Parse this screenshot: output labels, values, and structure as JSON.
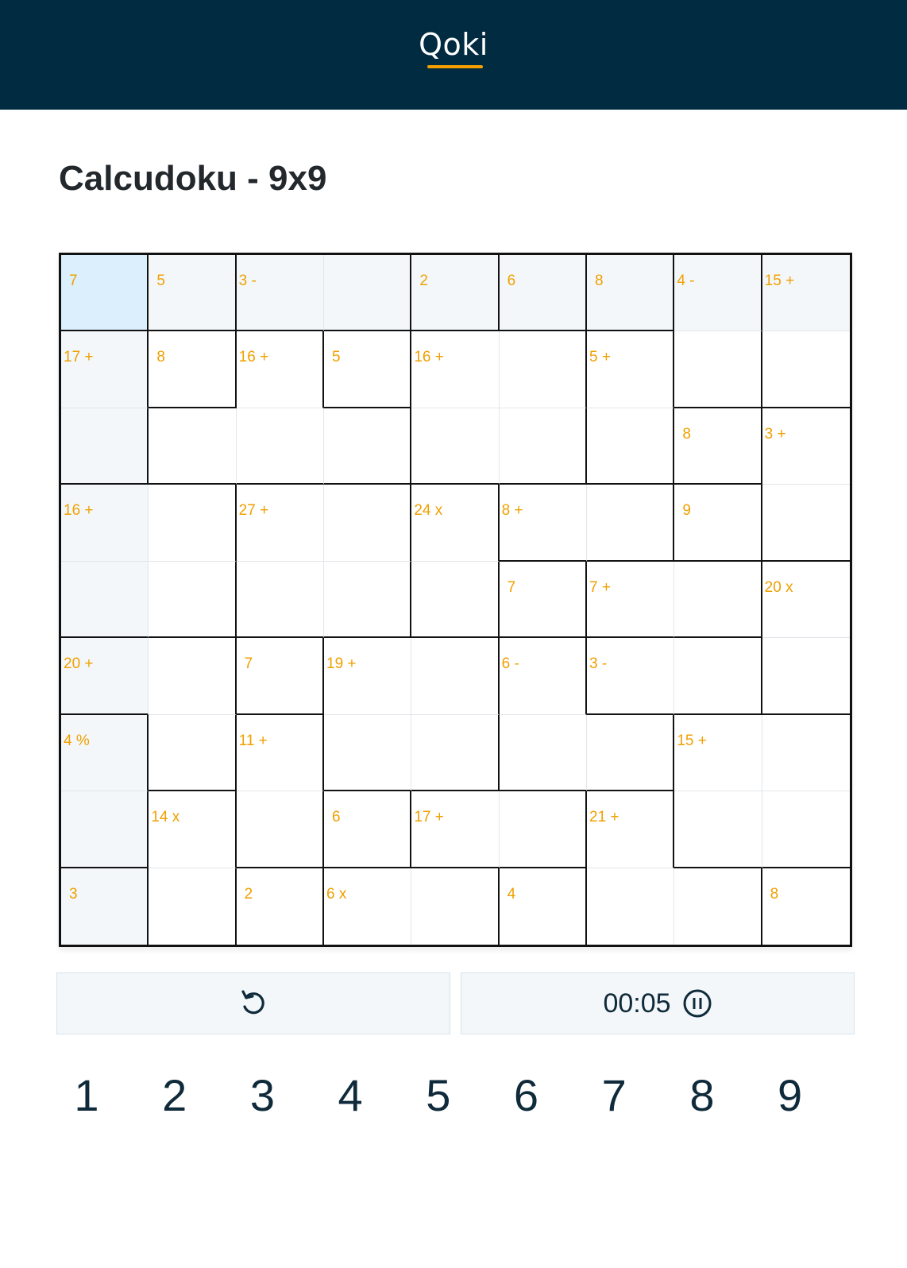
{
  "header": {
    "logo": "Qoki"
  },
  "page": {
    "title": "Calcudoku - 9x9"
  },
  "puzzle": {
    "size": 9,
    "selected": [
      0,
      0
    ],
    "accent_color": "#f0a000",
    "cage_map": [
      [
        0,
        1,
        2,
        2,
        3,
        4,
        5,
        6,
        7
      ],
      [
        8,
        9,
        10,
        11,
        12,
        12,
        13,
        6,
        7
      ],
      [
        8,
        10,
        10,
        10,
        12,
        12,
        13,
        14,
        15
      ],
      [
        16,
        16,
        17,
        17,
        18,
        19,
        19,
        20,
        15
      ],
      [
        16,
        16,
        17,
        17,
        18,
        21,
        22,
        22,
        23
      ],
      [
        24,
        24,
        25,
        26,
        26,
        27,
        28,
        28,
        23
      ],
      [
        29,
        24,
        30,
        26,
        26,
        27,
        27,
        31,
        31
      ],
      [
        29,
        32,
        30,
        33,
        34,
        34,
        35,
        31,
        31
      ],
      [
        36,
        32,
        37,
        38,
        38,
        39,
        35,
        35,
        40
      ]
    ],
    "cages": [
      {
        "id": 0,
        "label": "7",
        "row": 0,
        "col": 0
      },
      {
        "id": 1,
        "label": "5",
        "row": 0,
        "col": 1
      },
      {
        "id": 2,
        "label": "3 -",
        "row": 0,
        "col": 2
      },
      {
        "id": 3,
        "label": "2",
        "row": 0,
        "col": 4
      },
      {
        "id": 4,
        "label": "6",
        "row": 0,
        "col": 5
      },
      {
        "id": 5,
        "label": "8",
        "row": 0,
        "col": 6
      },
      {
        "id": 6,
        "label": "4 -",
        "row": 0,
        "col": 7
      },
      {
        "id": 7,
        "label": "15 +",
        "row": 0,
        "col": 8
      },
      {
        "id": 8,
        "label": "17 +",
        "row": 1,
        "col": 0
      },
      {
        "id": 9,
        "label": "8",
        "row": 1,
        "col": 1
      },
      {
        "id": 10,
        "label": "16 +",
        "row": 1,
        "col": 2
      },
      {
        "id": 11,
        "label": "5",
        "row": 1,
        "col": 3
      },
      {
        "id": 12,
        "label": "16 +",
        "row": 1,
        "col": 4
      },
      {
        "id": 13,
        "label": "5 +",
        "row": 1,
        "col": 6
      },
      {
        "id": 14,
        "label": "8",
        "row": 2,
        "col": 7
      },
      {
        "id": 15,
        "label": "3 +",
        "row": 2,
        "col": 8
      },
      {
        "id": 16,
        "label": "16 +",
        "row": 3,
        "col": 0
      },
      {
        "id": 17,
        "label": "27 +",
        "row": 3,
        "col": 2
      },
      {
        "id": 18,
        "label": "24 x",
        "row": 3,
        "col": 4
      },
      {
        "id": 19,
        "label": "8 +",
        "row": 3,
        "col": 5
      },
      {
        "id": 20,
        "label": "9",
        "row": 3,
        "col": 7
      },
      {
        "id": 21,
        "label": "7",
        "row": 4,
        "col": 5
      },
      {
        "id": 22,
        "label": "7 +",
        "row": 4,
        "col": 6
      },
      {
        "id": 23,
        "label": "20 x",
        "row": 4,
        "col": 8
      },
      {
        "id": 24,
        "label": "20 +",
        "row": 5,
        "col": 0
      },
      {
        "id": 25,
        "label": "7",
        "row": 5,
        "col": 2
      },
      {
        "id": 26,
        "label": "19 +",
        "row": 5,
        "col": 3
      },
      {
        "id": 27,
        "label": "6 -",
        "row": 5,
        "col": 5
      },
      {
        "id": 28,
        "label": "3 -",
        "row": 5,
        "col": 6
      },
      {
        "id": 29,
        "label": "4 %",
        "row": 6,
        "col": 0
      },
      {
        "id": 30,
        "label": "11 +",
        "row": 6,
        "col": 2
      },
      {
        "id": 31,
        "label": "15 +",
        "row": 6,
        "col": 7
      },
      {
        "id": 32,
        "label": "14 x",
        "row": 7,
        "col": 1
      },
      {
        "id": 33,
        "label": "6",
        "row": 7,
        "col": 3
      },
      {
        "id": 34,
        "label": "17 +",
        "row": 7,
        "col": 4
      },
      {
        "id": 35,
        "label": "21 +",
        "row": 7,
        "col": 6
      },
      {
        "id": 36,
        "label": "3",
        "row": 8,
        "col": 0
      },
      {
        "id": 37,
        "label": "2",
        "row": 8,
        "col": 2
      },
      {
        "id": 38,
        "label": "6 x",
        "row": 8,
        "col": 3
      },
      {
        "id": 39,
        "label": "4",
        "row": 8,
        "col": 5
      },
      {
        "id": 40,
        "label": "8",
        "row": 8,
        "col": 8
      }
    ]
  },
  "controls": {
    "reset_icon": "undo-icon",
    "timer": "00:05",
    "pause_icon": "pause-circle-icon"
  },
  "numpad": [
    "1",
    "2",
    "3",
    "4",
    "5",
    "6",
    "7",
    "8",
    "9"
  ]
}
